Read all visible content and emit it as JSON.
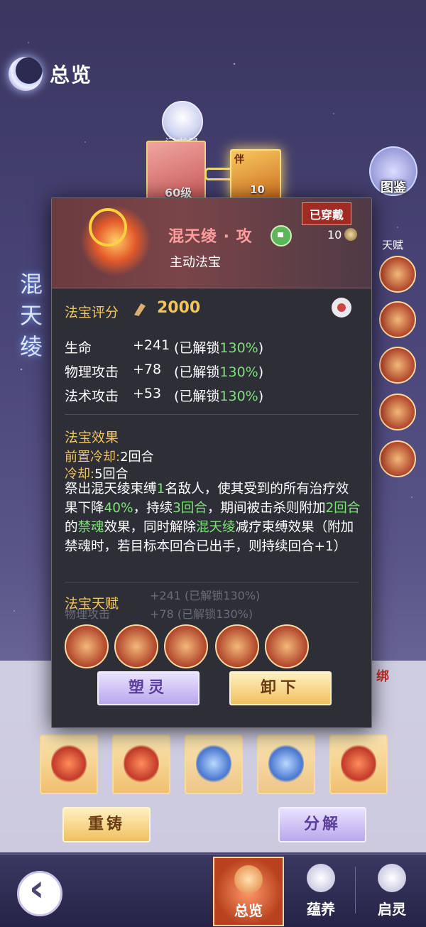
{
  "header": {
    "title": "总览",
    "vertical_name": "混\n天\n绫"
  },
  "top": {
    "character_label": "问书灵",
    "card1_level": "60级",
    "card2_tag": "伴",
    "card2_level": "10",
    "gallery_label": "图鉴"
  },
  "talents_side": {
    "label": "天赋"
  },
  "panel": {
    "equipped_badge": "已穿戴",
    "name": "混天绫 · 攻",
    "level": "10",
    "type": "主动法宝",
    "score_label": "法宝评分",
    "score_value": "2000",
    "stats": [
      {
        "name": "生命",
        "value": "+241",
        "unlock_prefix": "(已解锁",
        "unlock_pct": "130%",
        "unlock_suffix": ")"
      },
      {
        "name": "物理攻击",
        "value": "+78",
        "unlock_prefix": "(已解锁",
        "unlock_pct": "130%",
        "unlock_suffix": ")"
      },
      {
        "name": "法术攻击",
        "value": "+53",
        "unlock_prefix": "(已解锁",
        "unlock_pct": "130%",
        "unlock_suffix": ")"
      }
    ],
    "effect_title": "法宝效果",
    "pre_cooldown_label": "前置冷却:",
    "pre_cooldown_value": "2回合",
    "cooldown_label": "冷却:",
    "cooldown_value": "5回合",
    "effect_desc": {
      "p1": "祭出混天绫束缚",
      "n1": "1",
      "p2": "名敌人，使其受到的所有治疗效果下降",
      "n2": "40%",
      "p3": "，持续",
      "n3": "3回合",
      "p4": "，期间被击杀则附加",
      "n4": "2回合",
      "p5": "的",
      "n5": "禁魂",
      "p6": "效果，同时解除",
      "n6": "混天绫",
      "p7": "减疗束缚效果（附加禁魂时，若目标本回合已出手，则持续回合+1）"
    },
    "talent_title": "法宝天赋",
    "ghost_text": [
      "+241 (已解锁130%)",
      "物理攻击",
      "+78 (已解锁130%)"
    ],
    "button_reshape": "塑灵",
    "button_unequip": "卸下"
  },
  "bottom": {
    "recast_label": "重铸",
    "decompose_label": "分解",
    "bind_tag": "绑"
  },
  "nav": {
    "items": [
      {
        "label": "总览",
        "icon": "overview-icon"
      },
      {
        "label": "蕴养",
        "icon": "nurture-icon"
      },
      {
        "label": "启灵",
        "icon": "awaken-icon"
      }
    ]
  },
  "colors": {
    "gold": "#f2c55c",
    "green": "#7fe07a",
    "name_pink": "#ff9c9c",
    "badge_red": "#a02a24"
  }
}
